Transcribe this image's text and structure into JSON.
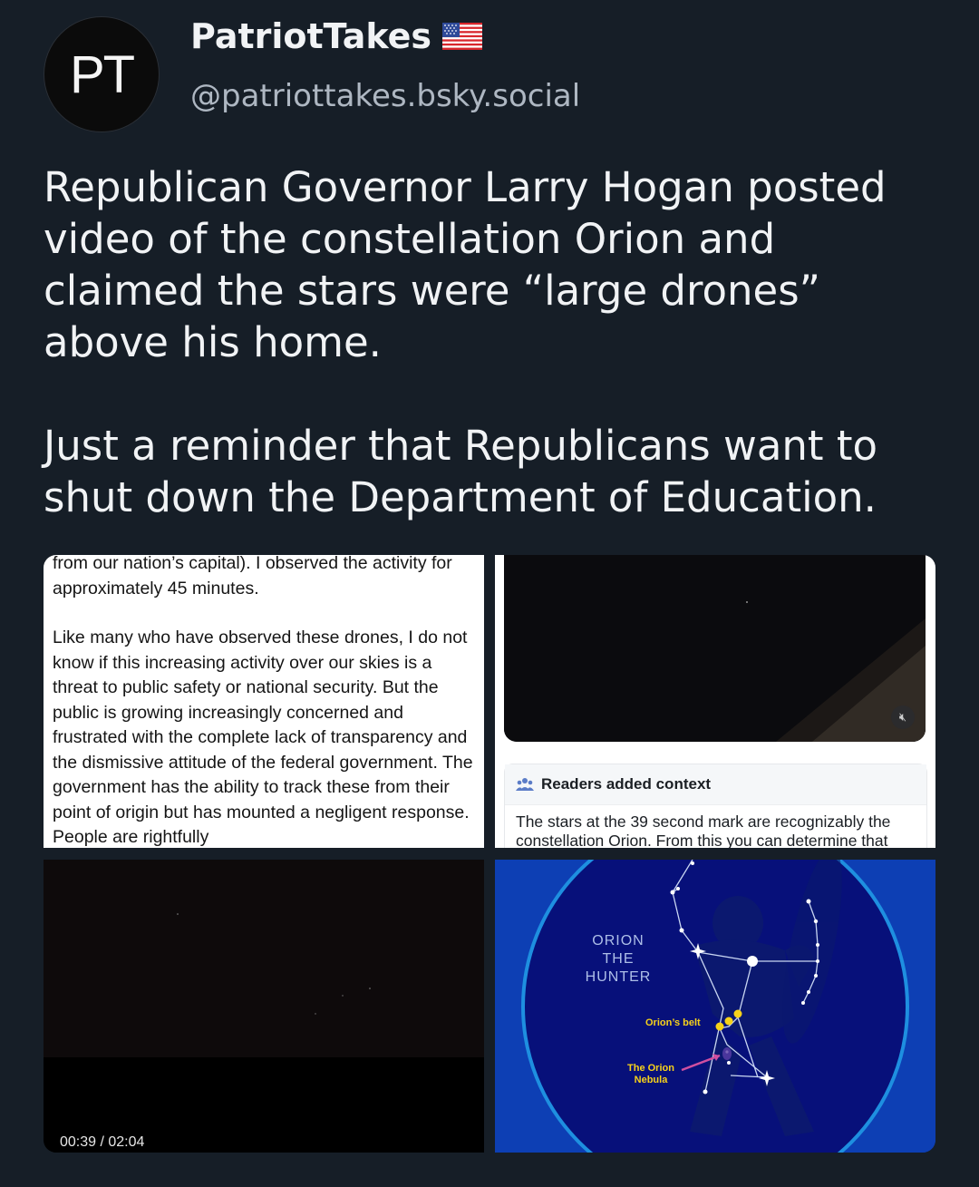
{
  "profile": {
    "avatar_text": "PT",
    "display_name": "PatriotTakes",
    "flag_icon": "us-flag-icon",
    "handle": "@patriottakes.bsky.social"
  },
  "post": {
    "paragraphs": [
      "Republican Governor Larry Hogan posted video of the constellation Orion and claimed the stars were “large drones” above his home.",
      "Just a reminder that Republicans want to shut down the Department of Education."
    ]
  },
  "images": {
    "letter": {
      "paragraphs": [
        "from our nation’s capital). I observed the activity for approximately 45 minutes.",
        "Like many who have observed these drones, I do not know if this increasing activity over our skies is a threat to public safety or national security. But the public is growing increasingly concerned and frustrated with the complete lack of transparency and the dismissive attitude of the federal government. The government has the ability to track these from their point of origin but has mounted a negligent response. People are rightfully"
      ]
    },
    "community_note": {
      "mute_icon": "speaker-muted-icon",
      "header_icon": "people-icon",
      "title": "Readers added context",
      "body": "The stars at the 39 second mark are recognizably the constellation Orion. From this you can determine that"
    },
    "video": {
      "timestamp": "00:39 / 02:04"
    },
    "orion_diagram": {
      "title": "ORION\nTHE\nHUNTER",
      "belt_label": "Orion’s belt",
      "nebula_label": "The Orion\nNebula"
    }
  },
  "colors": {
    "background": "#161e27",
    "text": "#f1f3f5",
    "handle": "#aeb7c2",
    "diagram_blue": "#0d3fb4",
    "belt_yellow": "#f7d21a"
  }
}
